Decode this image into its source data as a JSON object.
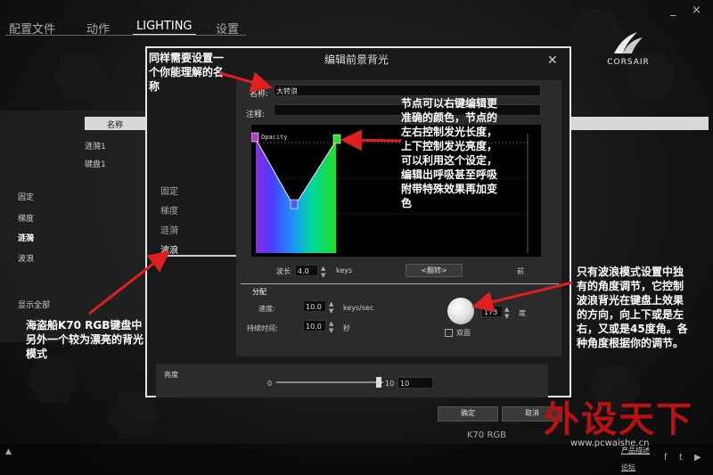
{
  "tabs": [
    {
      "label": "配置文件"
    },
    {
      "label": "动作"
    },
    {
      "label": "LIGHTING"
    },
    {
      "label": "设置"
    }
  ],
  "window": {
    "minimize": "_",
    "close": "×"
  },
  "logo": {
    "brand": "CORSAIR"
  },
  "list": {
    "header": "名称",
    "items": [
      "涟漪1",
      "键盘1"
    ]
  },
  "sidebar": {
    "items": [
      "固定",
      "梯度",
      "涟漪",
      "波浪"
    ],
    "show_all": "显示全部"
  },
  "dialog": {
    "title": "编辑前景背光",
    "name_label": "名称:",
    "name_value": "大转浪",
    "note_label": "注释:",
    "note_value": "",
    "graph_label": "Opacity",
    "modes": [
      "固定",
      "梯度",
      "涟漪",
      "波浪"
    ],
    "wavelength_label": "波长",
    "wavelength_value": "4.0",
    "wavelength_unit": "keys",
    "flip_button": "<翻转>",
    "front_label": "前",
    "section_label": "分配",
    "speed_label": "速度:",
    "speed_value": "10.0",
    "speed_unit": "keys/sec",
    "duration_label": "持续时间:",
    "duration_value": "10.0",
    "duration_unit": "秒",
    "angle_value": "173",
    "angle_unit": "度",
    "double_label": "双面",
    "brightness_label": "亮度",
    "brightness_min": "0",
    "brightness_max": "10",
    "brightness_value": "10",
    "ok_button": "确定",
    "cancel_button": "取消"
  },
  "device": "K70 RGB",
  "footer": {
    "link1": "产品描述",
    "link2": "论坛",
    "up_arrow": "▲"
  },
  "annotations": {
    "name_note": "同样需要设置一个你能理解的名称",
    "node_note": "节点可以右键编辑更准确的颜色，节点的左右控制发光长度，上下控制发光亮度，可以利用这个设定，编辑出呼吸甚至呼吸附带特殊效果再加变色",
    "wave_note": "海盗船K70 RGB键盘中另外一个较为漂亮的背光模式",
    "angle_note": "只有波浪模式设置中独有的角度调节，它控制波浪背光在键盘上效果的方向，向上下或是左右，又或是45度角。各种角度根据你的调节。"
  },
  "watermark": {
    "text": "外设天下",
    "url": "www.pcwaishe.cn"
  },
  "colors": {
    "accent_red": "#e02020",
    "graph_bg": "#000000"
  }
}
